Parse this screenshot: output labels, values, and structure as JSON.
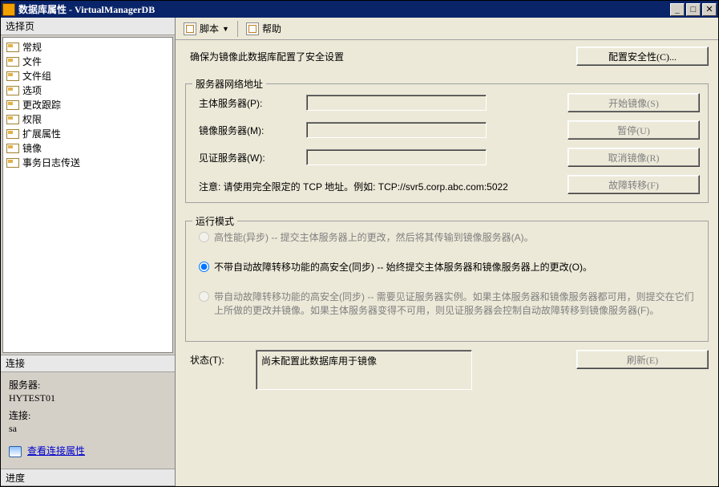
{
  "title": "数据库属性 - VirtualManagerDB",
  "left": {
    "select_header": "选择页",
    "items": [
      {
        "label": "常规"
      },
      {
        "label": "文件"
      },
      {
        "label": "文件组"
      },
      {
        "label": "选项"
      },
      {
        "label": "更改跟踪"
      },
      {
        "label": "权限"
      },
      {
        "label": "扩展属性"
      },
      {
        "label": "镜像"
      },
      {
        "label": "事务日志传送"
      }
    ],
    "conn_header": "连接",
    "server_label": "服务器:",
    "server_value": "HYTEST01",
    "conn_label": "连接:",
    "conn_value": "sa",
    "view_conn_props": "查看连接属性",
    "progress_header": "进度"
  },
  "toolbar": {
    "script": "脚本",
    "help": "帮助"
  },
  "content": {
    "security_msg": "确保为镜像此数据库配置了安全设置",
    "configure_security_btn": "配置安全性(C)...",
    "group_addr": {
      "legend": "服务器网络地址",
      "principal_label": "主体服务器(P):",
      "mirror_label": "镜像服务器(M):",
      "witness_label": "见证服务器(W):",
      "note": "注意: 请使用完全限定的 TCP 地址。例如: TCP://svr5.corp.abc.com:5022",
      "btn_start": "开始镜像(S)",
      "btn_pause": "暂停(U)",
      "btn_remove": "取消镜像(R)",
      "btn_failover": "故障转移(F)"
    },
    "group_mode": {
      "legend": "运行模式",
      "opt_highperf": "高性能(异步) -- 提交主体服务器上的更改，然后将其传输到镜像服务器(A)。",
      "opt_highsafe_noauto": "不带自动故障转移功能的高安全(同步) -- 始终提交主体服务器和镜像服务器上的更改(O)。",
      "opt_highsafe_auto": "带自动故障转移功能的高安全(同步) -- 需要见证服务器实例。如果主体服务器和镜像服务器都可用，则提交在它们上所做的更改并镜像。如果主体服务器变得不可用，则见证服务器会控制自动故障转移到镜像服务器(F)。"
    },
    "status_label": "状态(T):",
    "status_value": "尚未配置此数据库用于镜像",
    "refresh_btn": "刷新(E)"
  }
}
